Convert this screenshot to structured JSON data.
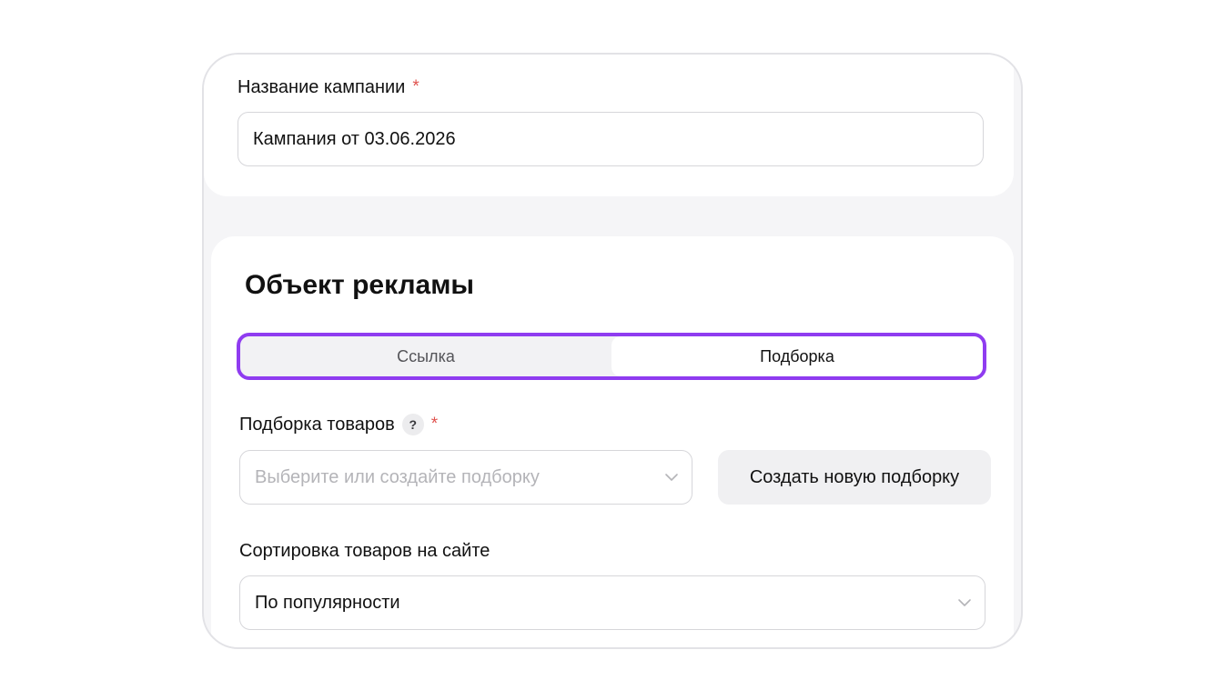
{
  "campaign": {
    "name_label": "Название кампании",
    "required_mark": "*",
    "name_value": "Кампания от 03.06.2026"
  },
  "ad_object": {
    "heading": "Объект рекламы",
    "tabs": [
      {
        "label": "Ссылка",
        "selected": false
      },
      {
        "label": "Подборка",
        "selected": true
      }
    ],
    "collection_label": "Подборка товаров",
    "help_glyph": "?",
    "required_mark": "*",
    "collection_placeholder": "Выберите или создайте подборку",
    "create_button": "Создать новую подборку",
    "sort_label": "Сортировка товаров на сайте",
    "sort_value": "По популярности"
  },
  "colors": {
    "accent_outline": "#8f3cf0",
    "required": "#e0534f",
    "panel_bg": "#f5f5f7"
  },
  "icons": {
    "dropdown": "chevron-down-icon",
    "help": "question-icon"
  }
}
